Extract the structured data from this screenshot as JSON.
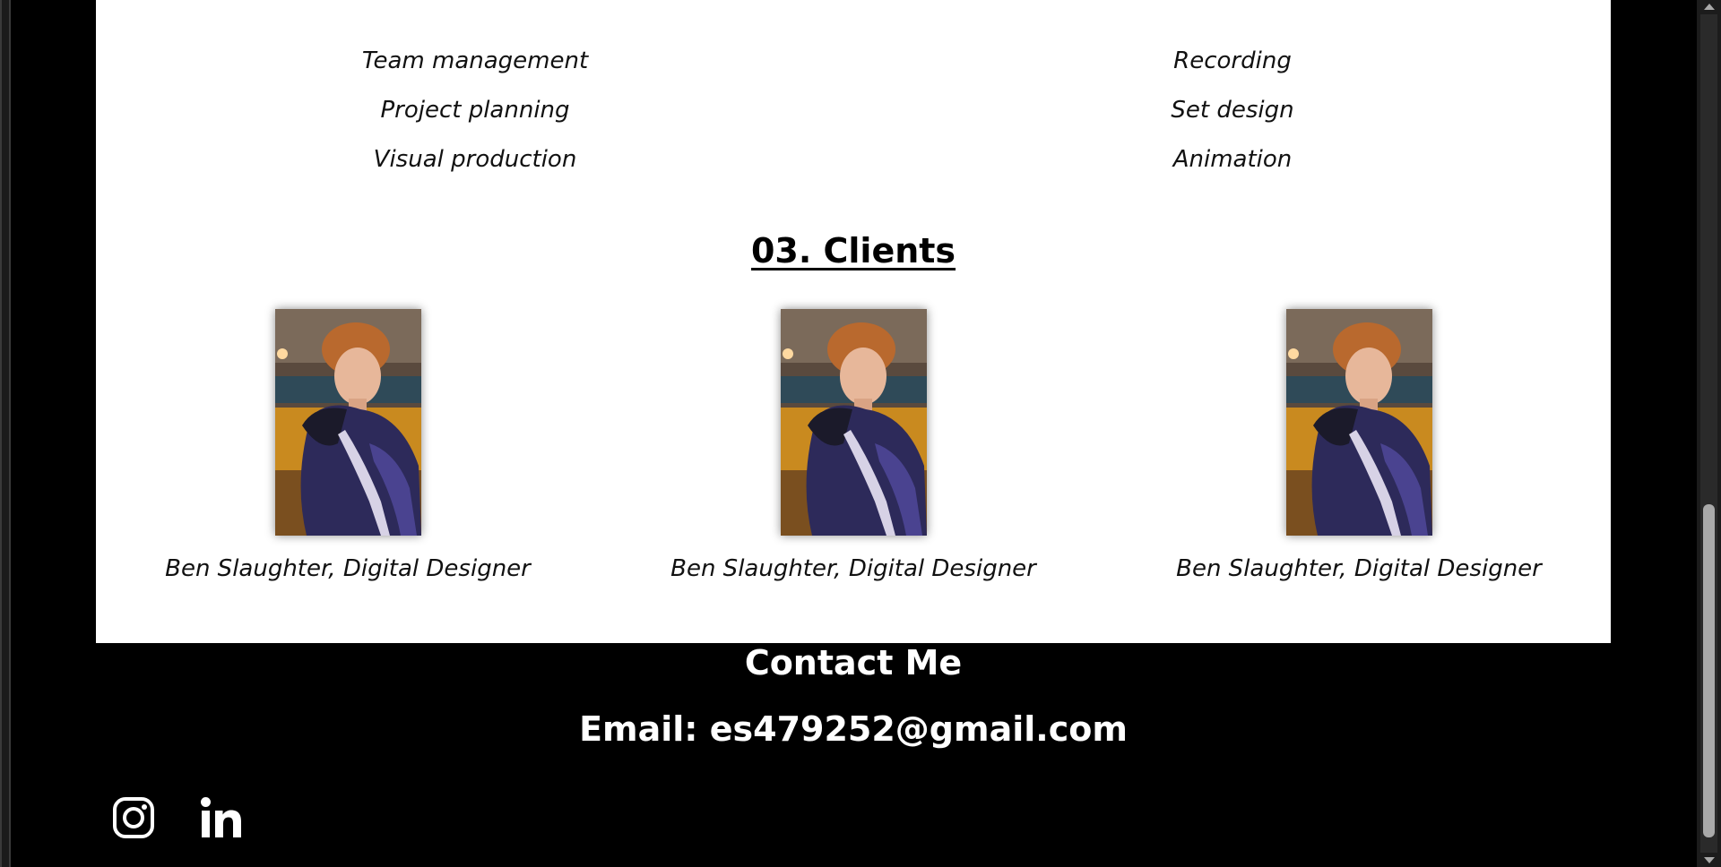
{
  "skills": {
    "left": [
      "Team management",
      "Project planning",
      "Visual production"
    ],
    "right": [
      "Recording",
      "Set design",
      "Animation"
    ]
  },
  "clients": {
    "title": "03. Clients",
    "items": [
      {
        "caption": "Ben Slaughter, Digital Designer"
      },
      {
        "caption": "Ben Slaughter, Digital Designer"
      },
      {
        "caption": "Ben Slaughter, Digital Designer"
      }
    ]
  },
  "contact": {
    "title": "Contact Me",
    "email": "Email: es479252@gmail.com"
  },
  "social": {
    "icons": [
      "instagram-icon",
      "linkedin-icon"
    ]
  },
  "colors": {
    "page_background": "#000000",
    "card_background": "#ffffff",
    "contact_text": "#ffffff"
  }
}
